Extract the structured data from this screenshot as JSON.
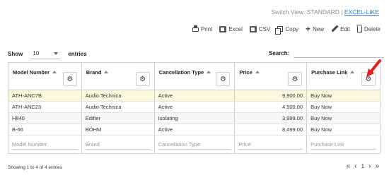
{
  "switch_view": {
    "prefix": "Switch View: STANDARD | ",
    "link": "EXCEL-LIKE"
  },
  "toolbar": {
    "print": "Print",
    "excel": "Excel",
    "csv": "CSV",
    "copy": "Copy",
    "new": "New",
    "edit": "Edit",
    "delete": "Delete"
  },
  "length": {
    "show": "Show",
    "value": "10",
    "entries": "entries"
  },
  "search": {
    "label": "Search:"
  },
  "columns": [
    "Model Number",
    "Brand",
    "Cancellation Type",
    "Price",
    "Purchase Link"
  ],
  "rows": [
    [
      "ATH-ANC7B",
      "Audio Technica",
      "Active",
      "9,900.00",
      "Buy Now"
    ],
    [
      "ATH-ANC23",
      "Audio Technica",
      "Active",
      "4,900.00",
      "Buy Now"
    ],
    [
      "H840",
      "Edifier",
      "Isolating",
      "3,999.00",
      "Buy Now"
    ],
    [
      "B-66",
      "BÖHM",
      "Active",
      "8,499.00",
      "Buy Now"
    ]
  ],
  "filters": [
    "Model Number",
    "Brand",
    "Cancellation Type",
    "Price",
    "Purchase Link"
  ],
  "info": "Showing 1 to 4 of 4 entries",
  "pager": {
    "first": "«",
    "prev": "‹",
    "page": "1",
    "next": "›",
    "last": "»"
  },
  "colors": {
    "accent_link": "#2a7fd4",
    "selected_row": "#fbf8dd",
    "arrow": "#e02020"
  }
}
